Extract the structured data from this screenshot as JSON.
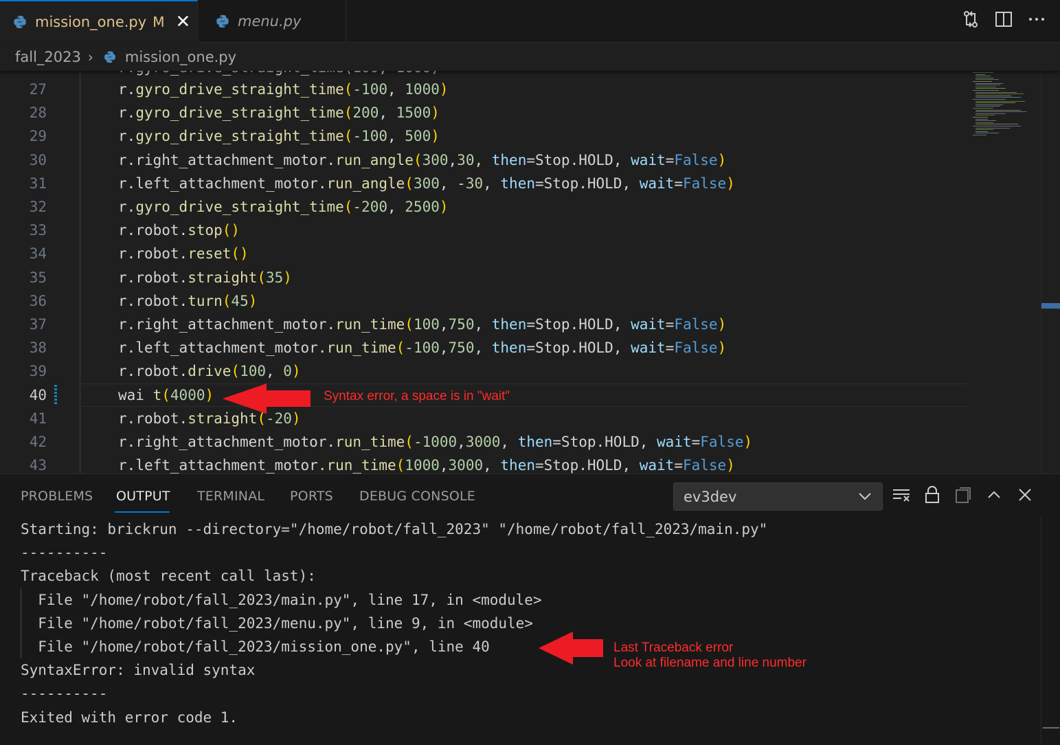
{
  "tabs": [
    {
      "label": "mission_one.py",
      "badge": "M",
      "active": true
    },
    {
      "label": "menu.py",
      "active": false
    }
  ],
  "breadcrumb": {
    "folder": "fall_2023",
    "file": "mission_one.py"
  },
  "editor": {
    "partial_top_line": "r.gyro_drive_straight_time(100, 1000)",
    "current_line": 40,
    "lines": [
      {
        "n": "27",
        "code": "r.gyro_drive_straight_time(-100, 1000)"
      },
      {
        "n": "28",
        "code": "r.gyro_drive_straight_time(200, 1500)"
      },
      {
        "n": "29",
        "code": "r.gyro_drive_straight_time(-100, 500)"
      },
      {
        "n": "30",
        "code": "r.right_attachment_motor.run_angle(300,30, then=Stop.HOLD, wait=False)"
      },
      {
        "n": "31",
        "code": "r.left_attachment_motor.run_angle(300, -30, then=Stop.HOLD, wait=False)"
      },
      {
        "n": "32",
        "code": "r.gyro_drive_straight_time(-200, 2500)"
      },
      {
        "n": "33",
        "code": "r.robot.stop()"
      },
      {
        "n": "34",
        "code": "r.robot.reset()"
      },
      {
        "n": "35",
        "code": "r.robot.straight(35)"
      },
      {
        "n": "36",
        "code": "r.robot.turn(45)"
      },
      {
        "n": "37",
        "code": "r.right_attachment_motor.run_time(100,750, then=Stop.HOLD, wait=False)"
      },
      {
        "n": "38",
        "code": "r.left_attachment_motor.run_time(-100,750, then=Stop.HOLD, wait=False)"
      },
      {
        "n": "39",
        "code": "r.robot.drive(100, 0)"
      },
      {
        "n": "40",
        "code": "wai t(4000)"
      },
      {
        "n": "41",
        "code": "r.robot.straight(-20)"
      },
      {
        "n": "42",
        "code": "r.right_attachment_motor.run_time(-1000,3000, then=Stop.HOLD, wait=False)"
      },
      {
        "n": "43",
        "code": "r.left_attachment_motor.run_time(1000,3000, then=Stop.HOLD, wait=False)"
      }
    ]
  },
  "annotations": {
    "syntax": "Syntax error, a space is in \"wait\"",
    "traceback_1": "Last Traceback error",
    "traceback_2": "Look at filename and line number",
    "color": "#ff2b2b"
  },
  "panel": {
    "tabs": [
      "PROBLEMS",
      "OUTPUT",
      "TERMINAL",
      "PORTS",
      "DEBUG CONSOLE"
    ],
    "active_tab": "OUTPUT",
    "channel": "ev3dev",
    "output": [
      "Starting: brickrun --directory=\"/home/robot/fall_2023\" \"/home/robot/fall_2023/main.py\"",
      "----------",
      "Traceback (most recent call last):",
      "  File \"/home/robot/fall_2023/main.py\", line 17, in <module>",
      "  File \"/home/robot/fall_2023/menu.py\", line 9, in <module>",
      "  File \"/home/robot/fall_2023/mission_one.py\", line 40",
      "SyntaxError: invalid syntax",
      "----------",
      "Exited with error code 1."
    ]
  },
  "icons": {
    "python": "python-file-icon",
    "compare": "compare-changes-icon",
    "split": "split-editor-icon",
    "more": "more-actions-icon",
    "clear": "clear-output-icon",
    "lock": "lock-scroll-icon",
    "copy": "open-output-editor-icon",
    "maximize": "chevron-up-icon",
    "close": "close-panel-icon"
  },
  "colors": {
    "accent": "#0078d4",
    "modified": "#e2c08d",
    "background": "#1f1f1f"
  }
}
